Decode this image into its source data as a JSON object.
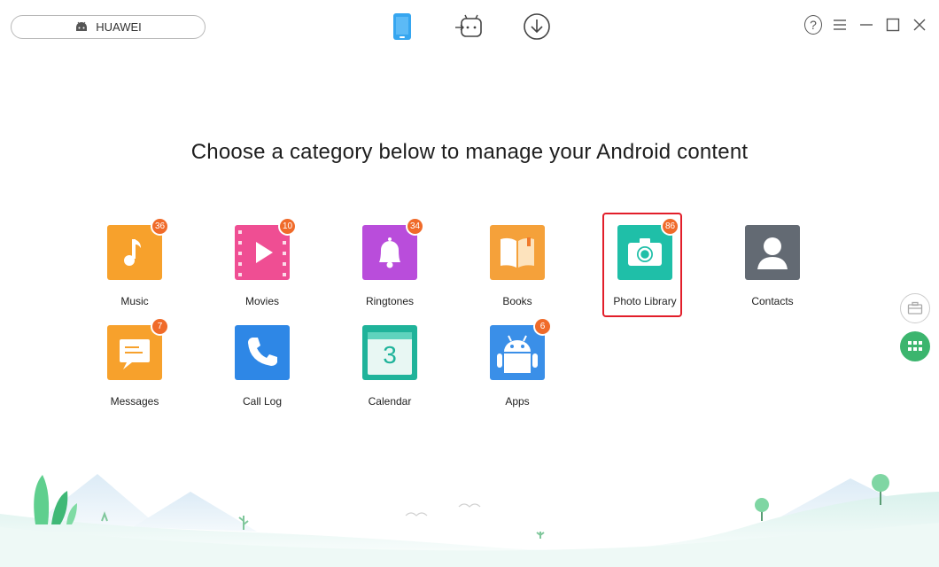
{
  "device": {
    "name": "HUAWEI",
    "icon": "android-icon"
  },
  "top_modes": [
    {
      "name": "phone-manager",
      "icon": "phone-icon",
      "active": true
    },
    {
      "name": "android-mover",
      "icon": "android-transfer-icon",
      "active": false
    },
    {
      "name": "downloader",
      "icon": "download-icon",
      "active": false
    }
  ],
  "window_controls": {
    "help_label": "?"
  },
  "headline": "Choose a category below to manage your Android content",
  "categories": [
    {
      "label": "Music",
      "badge": "36",
      "icon": "music-note-icon",
      "color": "#f7a12c"
    },
    {
      "label": "Movies",
      "badge": "10",
      "icon": "play-icon",
      "color": "#ef4e93"
    },
    {
      "label": "Ringtones",
      "badge": "34",
      "icon": "bell-icon",
      "color": "#b94ddb"
    },
    {
      "label": "Books",
      "badge": "",
      "icon": "book-icon",
      "color": "#f5a13a"
    },
    {
      "label": "Photo Library",
      "badge": "86",
      "icon": "camera-icon",
      "color": "#1fbfa8",
      "selected": true
    },
    {
      "label": "Contacts",
      "badge": "",
      "icon": "person-icon",
      "color": "#636a73"
    },
    {
      "label": "Messages",
      "badge": "7",
      "icon": "message-icon",
      "color": "#f7a12c"
    },
    {
      "label": "Call Log",
      "badge": "",
      "icon": "phone-call-icon",
      "color": "#2e87e6"
    },
    {
      "label": "Calendar",
      "badge": "",
      "icon": "calendar-icon",
      "color": "#1fb39a",
      "calendar_day": "3"
    },
    {
      "label": "Apps",
      "badge": "6",
      "icon": "android-app-icon",
      "color": "#3a8fe8"
    }
  ],
  "side_buttons": [
    {
      "name": "toolbox",
      "icon": "toolbox-icon"
    },
    {
      "name": "category-grid",
      "icon": "grid-icon",
      "color": "#3cb56e"
    }
  ],
  "accent": {
    "badge": "#f06b2a",
    "selection": "#e21e2a"
  }
}
